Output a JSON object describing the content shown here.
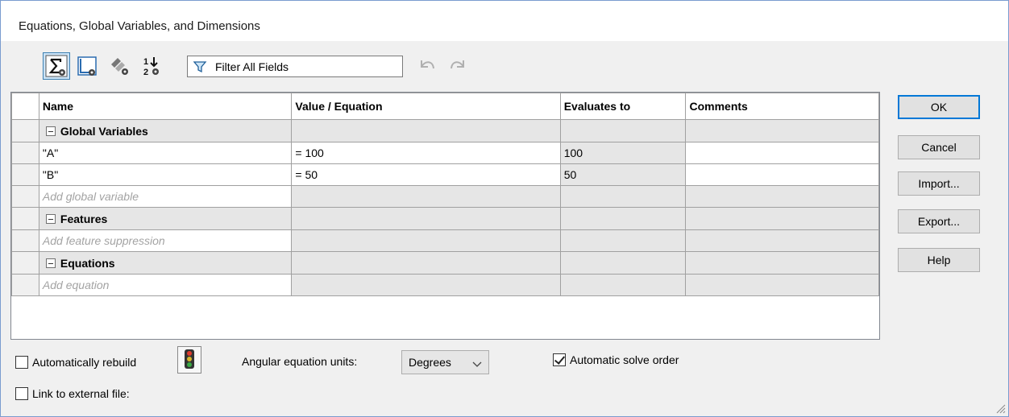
{
  "window": {
    "title": "Equations, Global Variables, and Dimensions"
  },
  "toolbar": {
    "buttons": [
      {
        "name": "equation-view-icon",
        "active": true
      },
      {
        "name": "sketch-equation-view-icon",
        "active": false
      },
      {
        "name": "dimension-view-icon",
        "active": false
      },
      {
        "name": "ordered-view-icon",
        "active": false
      }
    ],
    "filter_value": "Filter All Fields",
    "undo_icon": "undo-icon",
    "redo_icon": "redo-icon"
  },
  "table": {
    "columns": [
      "Name",
      "Value / Equation",
      "Evaluates to",
      "Comments"
    ],
    "sections": [
      {
        "label": "Global Variables",
        "rows": [
          {
            "name": "\"A\"",
            "value": "= 100",
            "evaluates": "100",
            "comments": ""
          },
          {
            "name": "\"B\"",
            "value": "= 50",
            "evaluates": "50",
            "comments": ""
          }
        ],
        "add_placeholder": "Add global variable"
      },
      {
        "label": "Features",
        "rows": [],
        "add_placeholder": "Add feature suppression"
      },
      {
        "label": "Equations",
        "rows": [],
        "add_placeholder": "Add equation"
      }
    ]
  },
  "buttons": {
    "ok": "OK",
    "cancel": "Cancel",
    "import": "Import...",
    "export": "Export...",
    "help": "Help"
  },
  "options": {
    "auto_rebuild_label": "Automatically rebuild",
    "auto_rebuild_checked": false,
    "angular_units_label": "Angular equation units:",
    "angular_units_value": "Degrees",
    "auto_solve_label": "Automatic solve order",
    "auto_solve_checked": true,
    "link_external_label": "Link to external file:",
    "link_external_checked": false
  },
  "colors": {
    "accent": "#0078d7",
    "grid_gray": "#e6e6e6",
    "placeholder_text": "#a3a3a3"
  }
}
